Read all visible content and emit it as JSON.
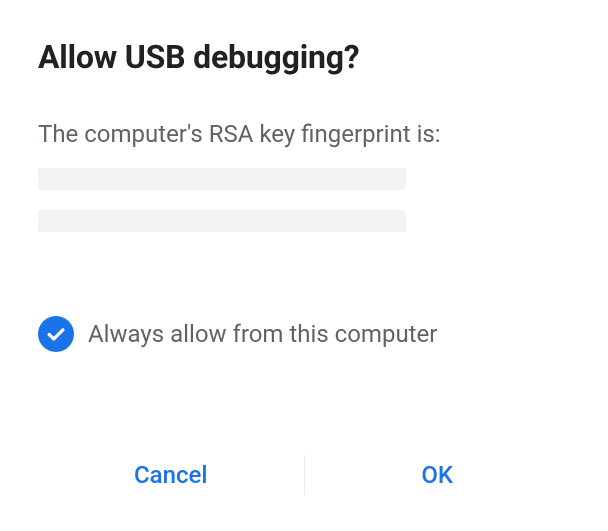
{
  "dialog": {
    "title": "Allow USB debugging?",
    "message": "The computer's RSA key fingerprint is:",
    "checkbox_label": "Always allow from this computer",
    "checkbox_checked": true,
    "icons": {
      "checkmark": "checkmark-icon"
    }
  },
  "buttons": {
    "cancel": "Cancel",
    "ok": "OK"
  },
  "colors": {
    "accent": "#1a73e8",
    "text_secondary": "#5f6368",
    "placeholder": "#f1f3f4"
  }
}
